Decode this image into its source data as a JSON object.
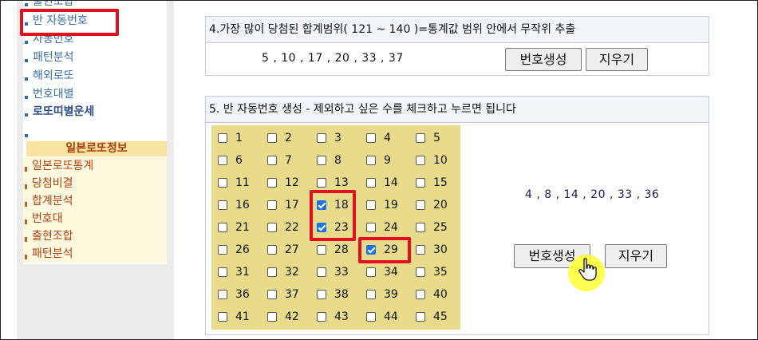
{
  "sidebar": {
    "top_nav": [
      {
        "label": "출현조합",
        "bold": false
      },
      {
        "label": "반 자동번호",
        "bold": false
      },
      {
        "label": "자동번호",
        "bold": false
      },
      {
        "label": "패턴분석",
        "bold": false
      },
      {
        "label": "해외로또",
        "bold": false
      },
      {
        "label": "번호대별",
        "bold": false
      },
      {
        "label": "로또띠별운세",
        "bold": true
      }
    ],
    "japan_header": "일본로또정보",
    "japan_items": [
      "일본로또통계",
      "당첨비결",
      "합계분석",
      "번호대",
      "출현조합",
      "패턴분석"
    ]
  },
  "section4": {
    "title": "4.가장 많이 당첨된 합계범위( 121 ~ 140 )=통계값 범위 안에서 무작위 추출",
    "result": "5 , 10 , 17 , 20 , 33 , 37",
    "generate_label": "번호생성",
    "clear_label": "지우기"
  },
  "section5": {
    "title": "5. 반 자동번호 생성 - 제외하고 싶은 수를 체크하고 누르면 됩니다",
    "result": "4 , 8 , 14 , 20 , 33 , 36",
    "generate_label": "번호생성",
    "clear_label": "지우기",
    "numbers": [
      "1",
      "2",
      "3",
      "4",
      "5",
      "6",
      "7",
      "8",
      "9",
      "10",
      "11",
      "12",
      "13",
      "14",
      "15",
      "16",
      "17",
      "18",
      "19",
      "20",
      "21",
      "22",
      "23",
      "24",
      "25",
      "26",
      "27",
      "28",
      "29",
      "30",
      "31",
      "32",
      "33",
      "34",
      "35",
      "36",
      "37",
      "38",
      "39",
      "40",
      "41",
      "42",
      "43",
      "44",
      "45"
    ],
    "checked": [
      "18",
      "23",
      "29"
    ]
  },
  "colors": {
    "highlight_red": "#e01020",
    "grid_background": "#e8dc8c",
    "checkbox_checked": "#1a73e8",
    "cursor_highlight": "#ffff33"
  },
  "icons": {
    "cursor": "hand-pointer-icon"
  }
}
